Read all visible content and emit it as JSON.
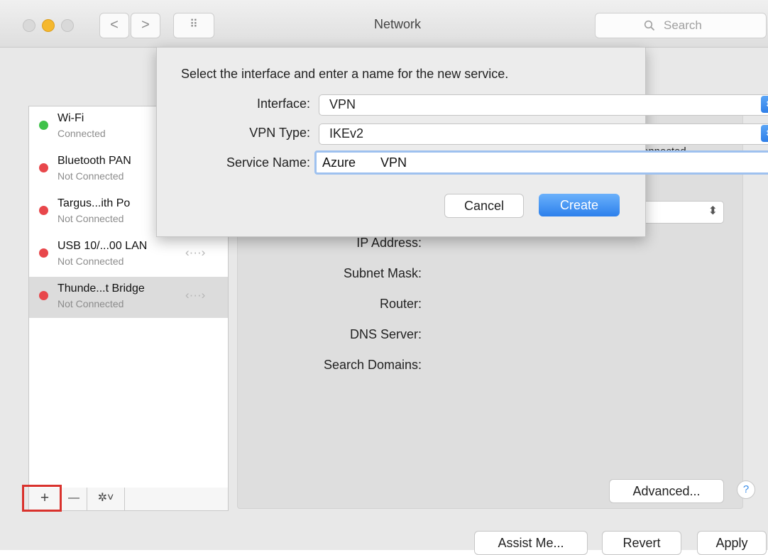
{
  "window": {
    "title": "Network",
    "search_placeholder": "Search",
    "search_icon": "magnifier",
    "back_icon": "<",
    "forward_icon": ">",
    "grid_icon": "⠿"
  },
  "sidebar": {
    "items": [
      {
        "name": "Wi-Fi",
        "status": "Connected",
        "status_color": "#3fc24a"
      },
      {
        "name": "Bluetooth PAN",
        "status": "Not Connected",
        "status_color": "#e8474b"
      },
      {
        "name": "Targus...ith Po",
        "status": "Not Connected",
        "status_color": "#e8474b"
      },
      {
        "name": "USB 10/...00 LAN",
        "status": "Not Connected",
        "status_color": "#e8474b"
      },
      {
        "name": "Thunde...t Bridge",
        "status": "Not Connected",
        "status_color": "#e8474b"
      }
    ],
    "add_label": "+",
    "remove_label": "—",
    "gear_label": "✲˅",
    "network_icon": "‹···›"
  },
  "details": {
    "connected_text": "onnected.",
    "ip_label": "IP Address:",
    "subnet_label": "Subnet Mask:",
    "router_label": "Router:",
    "dns_label": "DNS Server:",
    "search_domains_label": "Search Domains:"
  },
  "buttons": {
    "advanced": "Advanced...",
    "help": "?",
    "assist": "Assist Me...",
    "revert": "Revert",
    "apply": "Apply"
  },
  "dialog": {
    "prompt": "Select the interface and enter a name for the new service.",
    "interface_label": "Interface:",
    "interface_value": "VPN",
    "vpn_type_label": "VPN Type:",
    "vpn_type_value": "IKEv2",
    "service_name_label": "Service Name:",
    "service_name_value": "Azure       VPN",
    "cancel": "Cancel",
    "create": "Create"
  },
  "colors": {
    "accent": "#2c80ec",
    "highlight_box": "#d9322d"
  }
}
